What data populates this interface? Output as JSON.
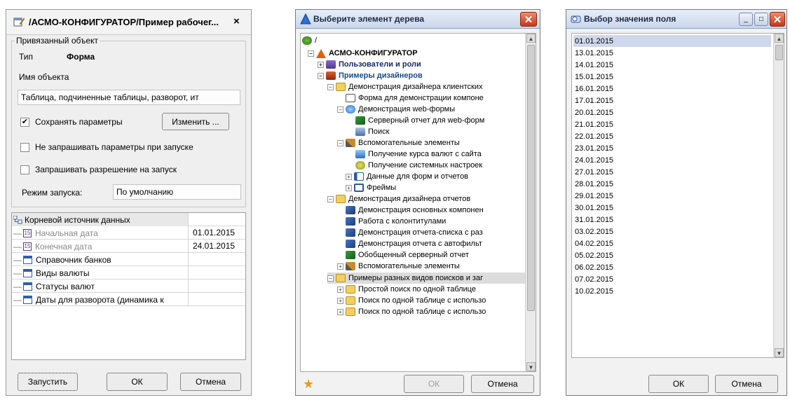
{
  "d1": {
    "title": "/АСМО-КОНФИГУРАТОР/Пример рабочег...",
    "close": "×",
    "group_label": "Привязанный объект",
    "type_label": "Тип",
    "type_value": "Форма",
    "name_label": "Имя объекта",
    "name_value": "Таблица, подчиненные таблицы, разворот, ит",
    "save_params": "Сохранять параметры",
    "save_checked": "✔",
    "change_button": "Изменить ...",
    "no_ask_params": "Не запрашивать параметры при запуске",
    "ask_permission": "Запрашивать разрешение на запуск",
    "mode_label": "Режим запуска:",
    "mode_value": "По умолчанию",
    "table_root": "Корневой источник данных",
    "rows": [
      {
        "name": "Начальная дата",
        "value": "01.01.2015"
      },
      {
        "name": "Конечная дата",
        "value": "24.01.2015"
      },
      {
        "name": "Справочник банков",
        "value": ""
      },
      {
        "name": "Виды валюты",
        "value": ""
      },
      {
        "name": "Статусы валют",
        "value": ""
      },
      {
        "name": "Даты для разворота (динамика к",
        "value": ""
      }
    ],
    "run_button": "Запустить",
    "ok_button": "ОК",
    "cancel_button": "Отмена"
  },
  "d2": {
    "title": "Выберите элемент дерева",
    "root": "/",
    "nodes": [
      "АСМО-КОНФИГУРАТОР",
      "Пользователи и роли",
      "Примеры дизайнеров",
      "Демонстрация дизайнера клиентских",
      "Форма для демонстрации компоне",
      "Демонстрация web-формы",
      "Серверный отчет для web-форм",
      "Поиск",
      "Вспомогательные элементы",
      "Получение курса валют с сайта",
      "Получение системных настроек",
      "Данные для форм и отчетов",
      "Фреймы",
      "Демонстрация дизайнера отчетов",
      "Демонстрация основных компонен",
      "Работа с колонтитулами",
      "Демонстрация отчета-списка с раз",
      "Демонстрация отчета с автофильт",
      "Обобщенный серверный отчет",
      "Вспомогательные элементы",
      "Примеры разных видов поисков и заг",
      "Простой поиск по одной таблице",
      "Поиск по одной таблице с использо",
      "Поиск по одной таблице с использо"
    ],
    "ok_button": "ОК",
    "cancel_button": "Отмена"
  },
  "d3": {
    "title": "Выбор значения поля",
    "selected": "01.01.2015",
    "dates": [
      "01.01.2015",
      "13.01.2015",
      "14.01.2015",
      "15.01.2015",
      "16.01.2015",
      "17.01.2015",
      "20.01.2015",
      "21.01.2015",
      "22.01.2015",
      "23.01.2015",
      "24.01.2015",
      "27.01.2015",
      "28.01.2015",
      "29.01.2015",
      "30.01.2015",
      "31.01.2015",
      "03.02.2015",
      "04.02.2015",
      "05.02.2015",
      "06.02.2015",
      "07.02.2015",
      "10.02.2015"
    ],
    "ok_button": "ОК",
    "cancel_button": "Отмена"
  }
}
